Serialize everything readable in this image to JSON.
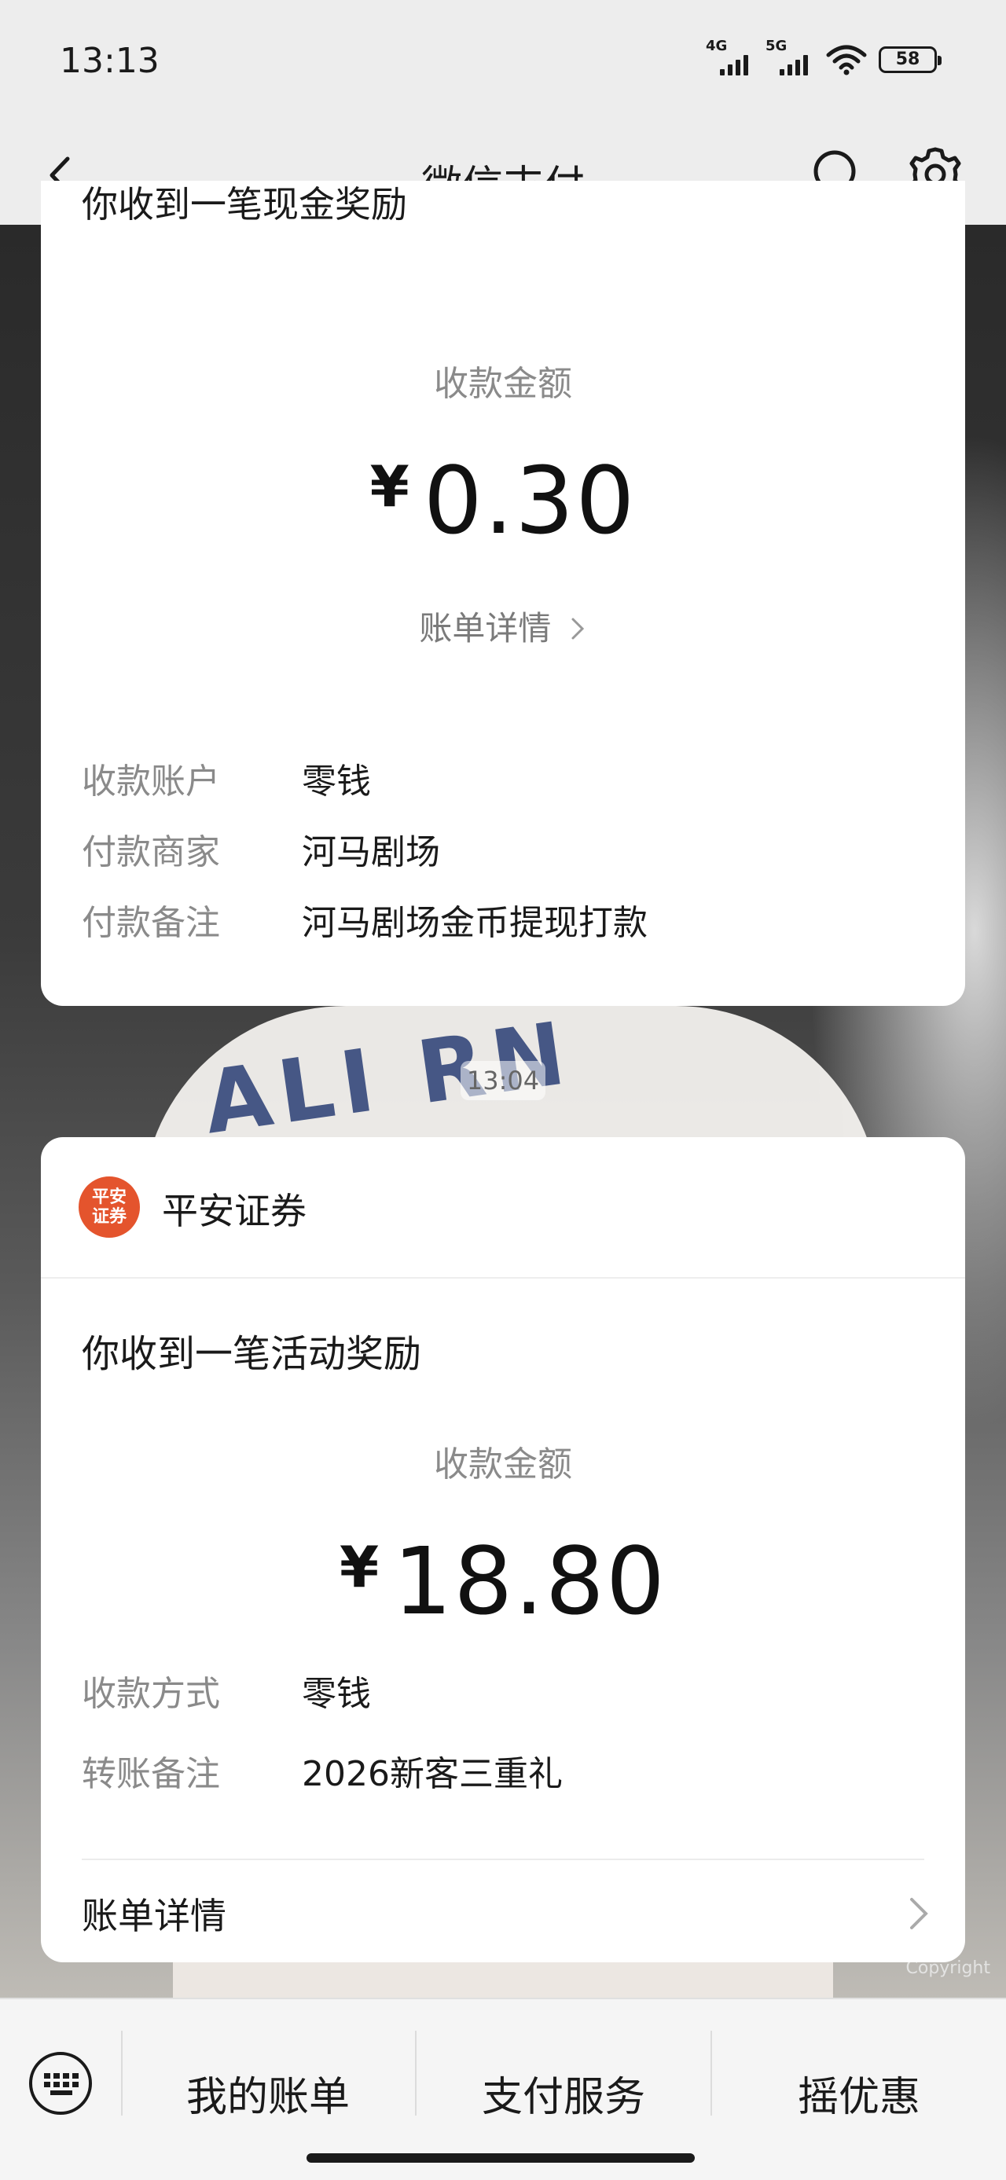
{
  "status": {
    "time": "13:13",
    "sig1": "4G",
    "sig2": "5G",
    "battery": "58"
  },
  "header": {
    "title": "微信支付"
  },
  "card1": {
    "clipped_title": "你收到一笔现金奖励",
    "amount_label": "收款金额",
    "currency": "¥",
    "amount": "0.30",
    "detail_link": "账单详情",
    "rows": [
      {
        "key": "收款账户",
        "value": "零钱"
      },
      {
        "key": "付款商家",
        "value": "河马剧场"
      },
      {
        "key": "付款备注",
        "value": "河马剧场金币提现打款"
      }
    ]
  },
  "time_divider": "13:04",
  "card2": {
    "merchant_logo_text": "平安证券",
    "merchant_name": "平安证券",
    "heading": "你收到一笔活动奖励",
    "amount_label": "收款金额",
    "currency": "¥",
    "amount": "18.80",
    "rows": [
      {
        "key": "收款方式",
        "value": "零钱"
      },
      {
        "key": "转账备注",
        "value": "2026新客三重礼"
      }
    ],
    "bill_detail": "账单详情"
  },
  "bottom": {
    "items": [
      "我的账单",
      "支付服务",
      "摇优惠"
    ]
  },
  "watermark": "Copyright"
}
